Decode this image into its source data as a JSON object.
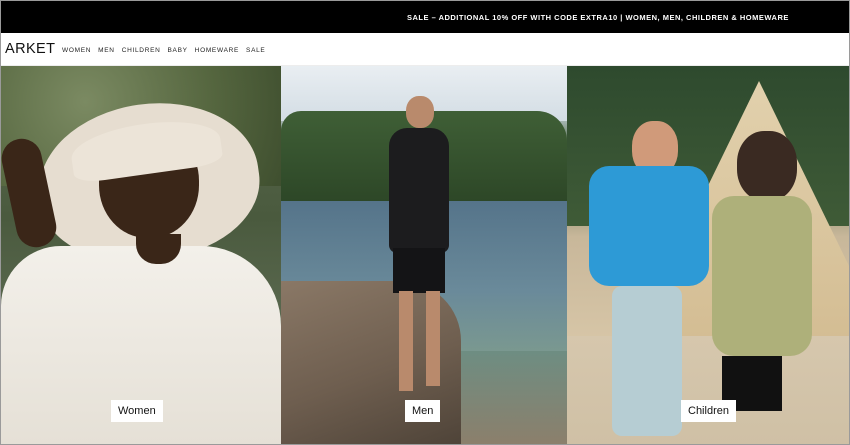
{
  "promo": {
    "text": "SALE – ADDITIONAL 10% OFF WITH CODE EXTRA10 | WOMEN, MEN, CHILDREN & HOMEWARE"
  },
  "header": {
    "logo": "ARKET",
    "nav": [
      "WOMEN",
      "MEN",
      "CHILDREN",
      "BABY",
      "HOMEWARE",
      "SALE"
    ]
  },
  "panels": {
    "women": {
      "label": "Women"
    },
    "men": {
      "label": "Men"
    },
    "children": {
      "label": "Children"
    }
  },
  "colors": {
    "promo_bg": "#000000",
    "promo_text": "#ffffff",
    "header_bg": "#ffffff"
  }
}
